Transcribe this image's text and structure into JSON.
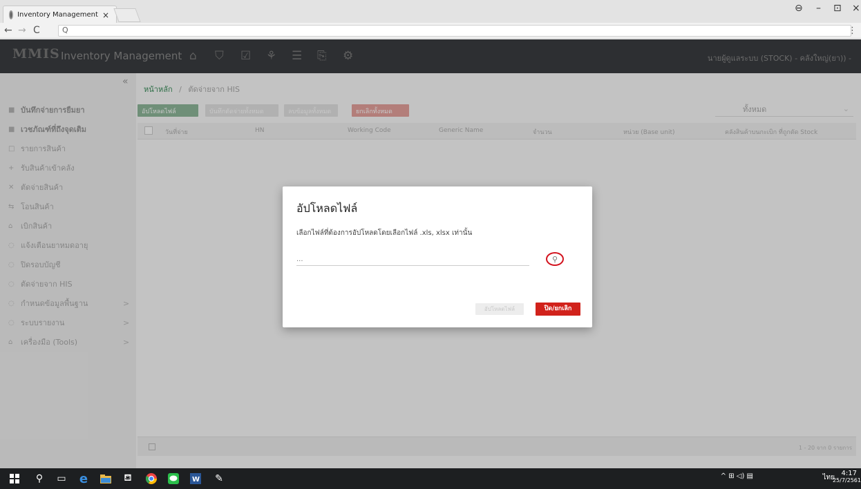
{
  "browser": {
    "tab_title": "Inventory Management",
    "tab_close": "×",
    "address": "Q",
    "nav_back": "←",
    "nav_forward": "→",
    "nav_reload": "C",
    "menu": "⋮",
    "win_user": "⊖",
    "win_min": "–",
    "win_max": "⊡",
    "win_close": "×"
  },
  "app": {
    "logo": "MMIS",
    "title": "Inventory Management",
    "nav_icons": [
      "home-icon",
      "cart-icon",
      "checkbox-icon",
      "bag-icon",
      "list-icon",
      "clipboard-icon",
      "gear-icon"
    ],
    "user": "นายผู้ดูแลระบบ (STOCK) - คลังใหญ่(ยา)) -"
  },
  "sidebar": {
    "collapse": "«",
    "items": [
      {
        "label": "บันทึกจ่ายการยืมยา",
        "icon": "■",
        "bold": true
      },
      {
        "label": "เวชภัณฑ์ที่ถึงจุดเติม",
        "icon": "■",
        "bold": true
      },
      {
        "label": "รายการสินค้า",
        "icon": "□"
      },
      {
        "label": "รับสินค้าเข้าคลัง",
        "icon": "+"
      },
      {
        "label": "ตัดจ่ายสินค้า",
        "icon": "✕"
      },
      {
        "label": "โอนสินค้า",
        "icon": "⇆"
      },
      {
        "label": "เบิกสินค้า",
        "icon": "⌂"
      },
      {
        "label": "แจ้งเตือนยาหมดอายุ",
        "icon": "◌"
      },
      {
        "label": "ปิดรอบบัญชี",
        "icon": "◌"
      },
      {
        "label": "ตัดจ่ายจาก HIS",
        "icon": "◌"
      },
      {
        "label": "กำหนดข้อมูลพื้นฐาน",
        "icon": "◌",
        "chevron": ">"
      },
      {
        "label": "ระบบรายงาน",
        "icon": "◌",
        "chevron": ">"
      },
      {
        "label": "เครื่องมือ (Tools)",
        "icon": "⌂",
        "chevron": ">"
      }
    ]
  },
  "breadcrumb": {
    "home": "หน้าหลัก",
    "sep": "/",
    "current": "ตัดจ่ายจาก HIS"
  },
  "toolbar": {
    "upload": "อัปโหลดไฟล์",
    "btn2": "บันทึกตัดจ่ายทั้งหมด",
    "btn3": "ลบข้อมูลทั้งหมด",
    "cancel_all": "ยกเลิกทั้งหมด",
    "filter_value": "ทั้งหมด",
    "filter_caret": "⌄"
  },
  "table": {
    "columns": [
      "วันที่จ่าย",
      "HN",
      "Working Code",
      "Generic Name",
      "จำนวน",
      "หน่วย (Base unit)",
      "คลังสินค้าบนกะเบิก ที่ถูกตัด Stock"
    ],
    "pager": "1 - 20 จาก 0 รายการ"
  },
  "modal": {
    "title": "อัปโหลดไฟล์",
    "description": "เลือกไฟล์ที่ต้องการอัปโหลดโดยเลือกไฟล์ .xls, xlsx เท่านั้น",
    "file_placeholder": "...",
    "search_icon": "⚲",
    "upload_button": "อัปโหลดไฟล์",
    "close_button": "ปิด/ยกเลิก"
  },
  "taskbar": {
    "apps": [
      "windows-icon",
      "search-icon",
      "task-view-icon",
      "edge-icon",
      "explorer-icon",
      "store-icon",
      "chrome-icon",
      "line-icon",
      "word-icon",
      "paint-icon"
    ],
    "tray_icons": "^ ⊞ ◁) ▤",
    "lang": "ไทย",
    "time": "4:17",
    "date": "25/7/2561"
  }
}
